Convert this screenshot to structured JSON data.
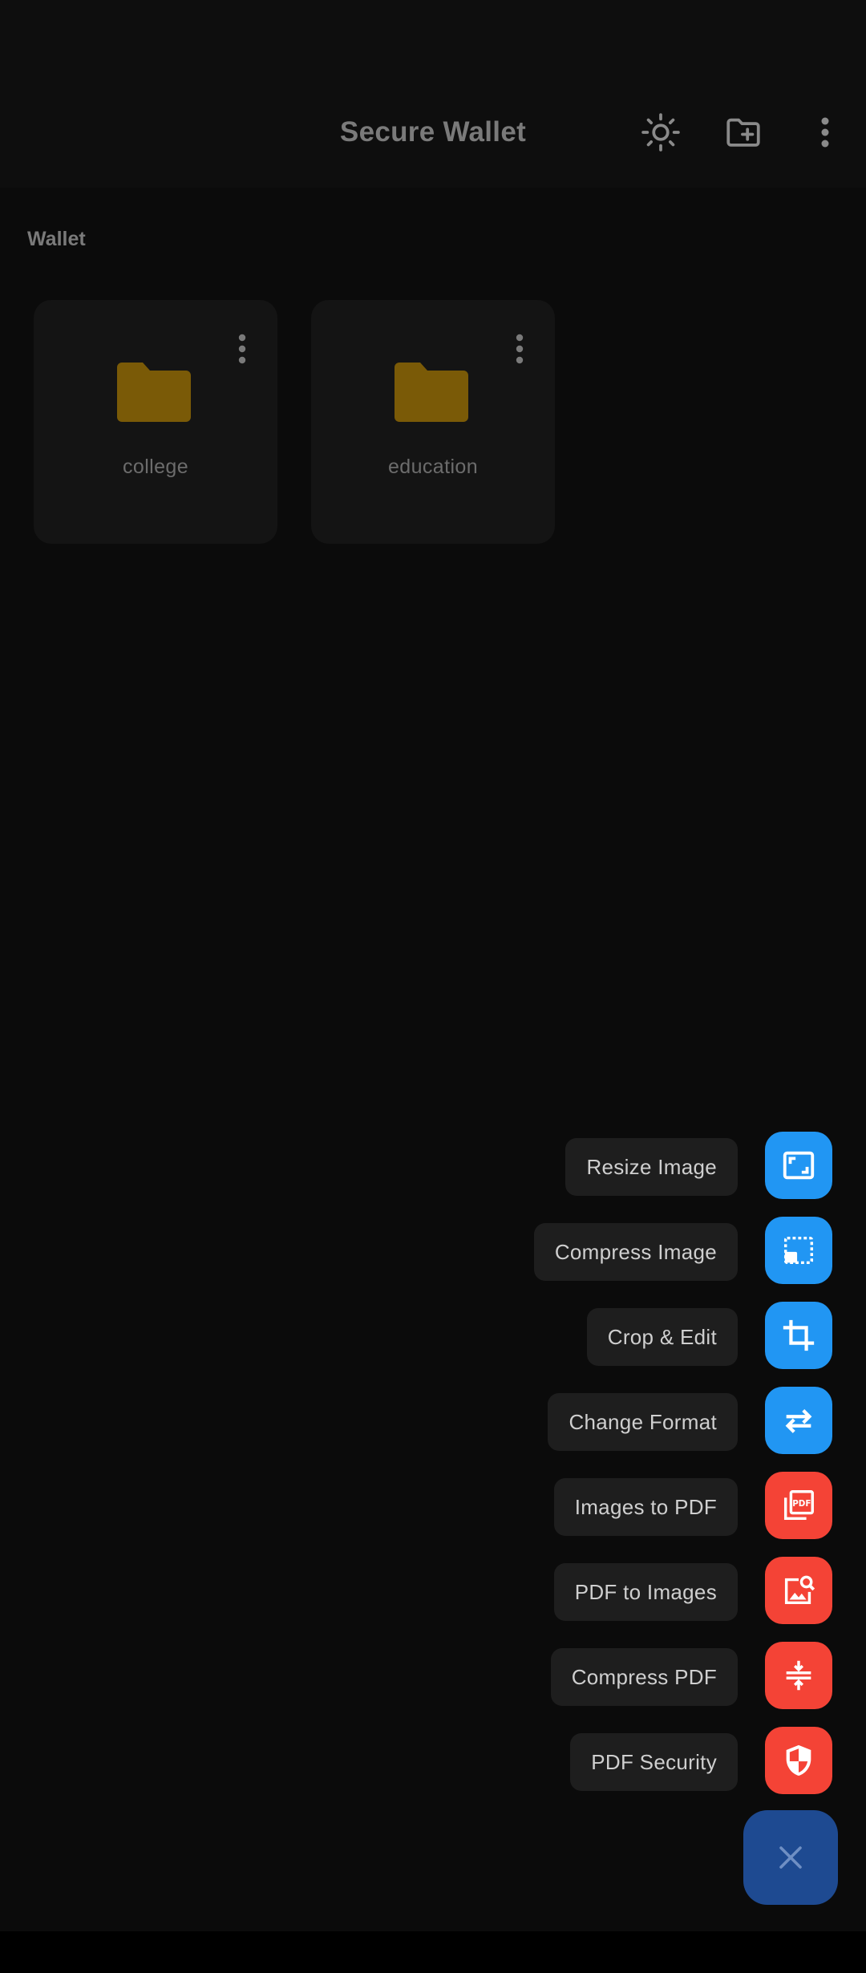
{
  "app_bar": {
    "title": "Secure Wallet",
    "actions": [
      {
        "icon": "brightness-icon"
      },
      {
        "icon": "new-folder-icon"
      },
      {
        "icon": "more-vert-icon"
      }
    ]
  },
  "section": {
    "label": "Wallet"
  },
  "folders": [
    {
      "name": "college",
      "icon": "folder-icon",
      "color": "#7a5a07"
    },
    {
      "name": "education",
      "icon": "folder-icon",
      "color": "#7a5a07"
    }
  ],
  "speed_dial": {
    "items": [
      {
        "label": "Resize Image",
        "icon": "resize-image-icon",
        "color": "#2196f3"
      },
      {
        "label": "Compress Image",
        "icon": "compress-image-icon",
        "color": "#2196f3"
      },
      {
        "label": "Crop & Edit",
        "icon": "crop-icon",
        "color": "#2196f3"
      },
      {
        "label": "Change Format",
        "icon": "swap-icon",
        "color": "#2196f3"
      },
      {
        "label": "Images to PDF",
        "icon": "picture-as-pdf-icon",
        "color": "#f44336"
      },
      {
        "label": "PDF to Images",
        "icon": "image-search-icon",
        "color": "#f44336"
      },
      {
        "label": "Compress PDF",
        "icon": "compress-icon",
        "color": "#f44336"
      },
      {
        "label": "PDF Security",
        "icon": "shield-icon",
        "color": "#f44336"
      }
    ],
    "main_icon": "close-icon",
    "main_color": "#1e4a91"
  }
}
